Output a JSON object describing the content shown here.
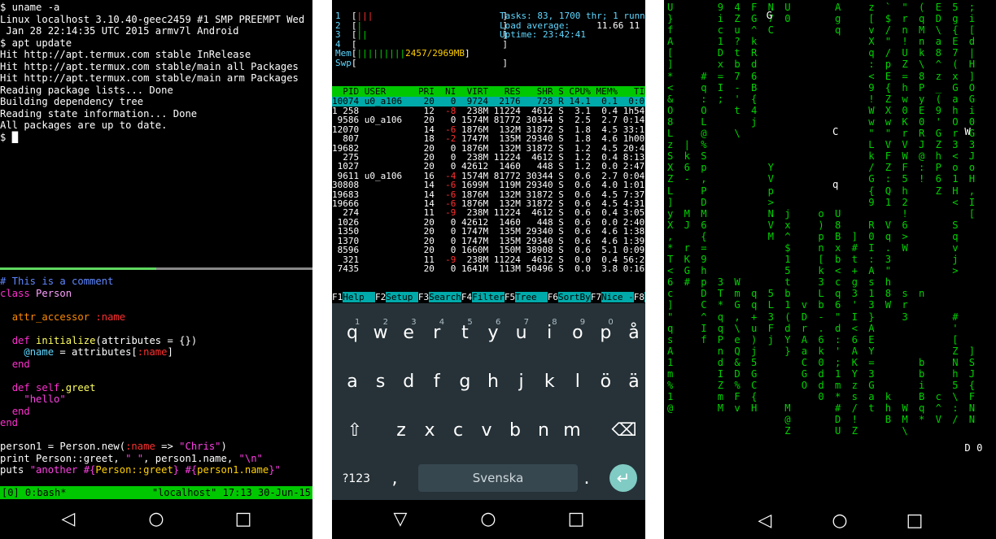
{
  "panel1": {
    "terminal_lines": [
      "$ uname -a",
      "Linux localhost 3.10.40-geec2459 #1 SMP PREEMPT Wed",
      " Jan 28 22:14:35 UTC 2015 armv7l Android",
      "$ apt update",
      "Hit http://apt.termux.com stable InRelease",
      "Hit http://apt.termux.com stable/main all Packages",
      "Hit http://apt.termux.com stable/main arm Packages",
      "Reading package lists... Done",
      "Building dependency tree",
      "Reading state information... Done",
      "All packages are up to date.",
      "$ "
    ],
    "code": {
      "comment": "# This is a comment",
      "class_kw": "class",
      "class_name": "Person",
      "attr_accessor": "attr_accessor",
      "attr_sym": ":name",
      "def1_kw": "def",
      "def1_name": "initialize",
      "def1_args": "(attributes = {})",
      "ivar": "@name",
      "ivar_assign": " = attributes[",
      "ivar_sym": ":name",
      "ivar_close": "]",
      "end1": "end",
      "def2_kw": "def",
      "def2_self": "self",
      "def2_name": ".greet",
      "hello": "\"hello\"",
      "end2": "end",
      "end3": "end",
      "line_new_a": "person1 = Person.new(",
      "line_new_sym": ":name",
      "line_new_b": " => ",
      "line_new_str": "\"Chris\"",
      "line_new_c": ")",
      "line_print_a": "print Person::greet, ",
      "line_print_s1": "\" \"",
      "line_print_b": ", person1.name, ",
      "line_print_s2": "\"\\n\"",
      "line_puts_a": "puts ",
      "line_puts_s": "\"another #{",
      "line_puts_m": "Person::greet",
      "line_puts_s2": "} #{",
      "line_puts_m2": "person1.name",
      "line_puts_s3": "}\""
    },
    "status_left": "[0] 0:bash*",
    "status_right": "\"localhost\" 17:13 30-Jun-15"
  },
  "panel2": {
    "cpu_lines": [
      "1  [|||                        ]",
      "2  [|                          ]",
      "3  [||                         ]",
      "4  [                           ]",
      "Mem[|||||||||2457/2969MB]",
      "Swp[                           ]"
    ],
    "tasks_line": "Tasks: 83, 1700 thr; 1 runni",
    "load_label": "Load average:",
    "load_value": "11.66 11",
    "uptime_line": "Uptime: 23:42:41",
    "header": "  PID USER      PRI  NI  VIRT   RES   SHR S CPU% MEM%   TIME",
    "selected_row": "10074 u0_a106    20   0  9724  2176   728 R 14.1  0.1  0:01.",
    "rows": [
      [
        "1 258",
        "",
        "12",
        "-8",
        "238M",
        "11224",
        "4612",
        "S",
        "3.1",
        "0.4",
        "1h54:"
      ],
      [
        "9586",
        "u0_a106",
        "20",
        "0",
        "1574M",
        "81772",
        "30344",
        "S",
        "2.5",
        "2.7",
        "0:14."
      ],
      [
        "12070",
        "",
        "14",
        "-6",
        "1876M",
        "132M",
        "31872",
        "S",
        "1.8",
        "4.5",
        "33:16."
      ],
      [
        "807",
        "",
        "18",
        "-2",
        "1747M",
        "135M",
        "29340",
        "S",
        "1.8",
        "4.6",
        "1h00:"
      ],
      [
        "19682",
        "",
        "20",
        "0",
        "1876M",
        "132M",
        "31872",
        "S",
        "1.2",
        "4.5",
        "20:45."
      ],
      [
        "275",
        "",
        "20",
        "0",
        "238M",
        "11224",
        "4612",
        "S",
        "1.2",
        "0.4",
        "8:13."
      ],
      [
        "1027",
        "",
        "20",
        "0",
        "42612",
        "1460",
        "448",
        "S",
        "1.2",
        "0.0",
        "2:47."
      ],
      [
        "9611",
        "u0_a106",
        "16",
        "-4",
        "1574M",
        "81772",
        "30344",
        "S",
        "0.6",
        "2.7",
        "0:04."
      ],
      [
        "30808",
        "",
        "14",
        "-6",
        "1699M",
        "119M",
        "29340",
        "S",
        "0.6",
        "4.0",
        "1:01."
      ],
      [
        "19683",
        "",
        "14",
        "-6",
        "1876M",
        "132M",
        "31872",
        "S",
        "0.6",
        "4.5",
        "7:37."
      ],
      [
        "19666",
        "",
        "14",
        "-6",
        "1876M",
        "132M",
        "31872",
        "S",
        "0.6",
        "4.5",
        "4:31."
      ],
      [
        "274",
        "",
        "11",
        "-9",
        "238M",
        "11224",
        "4612",
        "S",
        "0.6",
        "0.4",
        "3:05."
      ],
      [
        "1026",
        "",
        "20",
        "0",
        "42612",
        "1460",
        "448",
        "S",
        "0.6",
        "0.0",
        "2:40."
      ],
      [
        "1350",
        "",
        "20",
        "0",
        "1747M",
        "135M",
        "29340",
        "S",
        "0.6",
        "4.6",
        "1:38."
      ],
      [
        "1370",
        "",
        "20",
        "0",
        "1747M",
        "135M",
        "29340",
        "S",
        "0.6",
        "4.6",
        "1:39."
      ],
      [
        "8596",
        "",
        "20",
        "0",
        "1660M",
        "150M",
        "38908",
        "S",
        "0.6",
        "5.1",
        "0:09."
      ],
      [
        "321",
        "",
        "11",
        "-9",
        "238M",
        "11224",
        "4612",
        "S",
        "0.0",
        "0.4",
        "56:22."
      ],
      [
        "7435",
        "",
        "20",
        "0",
        "1641M",
        "113M",
        "50496",
        "S",
        "0.0",
        "3.8",
        "0:16."
      ]
    ],
    "fkeys": [
      {
        "k": "F1",
        "v": "Help  "
      },
      {
        "k": "F2",
        "v": "Setup "
      },
      {
        "k": "F3",
        "v": "Search"
      },
      {
        "k": "F4",
        "v": "Filter"
      },
      {
        "k": "F5",
        "v": "Tree  "
      },
      {
        "k": "F6",
        "v": "SortBy"
      },
      {
        "k": "F7",
        "v": "Nice -"
      },
      {
        "k": "F8",
        "v": "Ni"
      }
    ],
    "keyboard": {
      "row1": [
        "q",
        "w",
        "e",
        "r",
        "t",
        "y",
        "u",
        "i",
        "o",
        "p",
        "å"
      ],
      "row1_hints": [
        "1",
        "2",
        "3",
        "4",
        "5",
        "6",
        "7",
        "8",
        "9",
        "0",
        ""
      ],
      "row2": [
        "a",
        "s",
        "d",
        "f",
        "g",
        "h",
        "j",
        "k",
        "l",
        "ö",
        "ä"
      ],
      "row3": [
        "z",
        "x",
        "c",
        "v",
        "b",
        "n",
        "m"
      ],
      "symbols": "?123",
      "comma": ",",
      "space": "Svenska",
      "period": "."
    }
  },
  "panel3": {
    "columns": [
      {
        "c": "U\n}\nf\nA\n[\n]\n*\n<\n&\nO\n8\nL\nz\nS\nX\nZ\nL\n]\ny\nX\n,\n*\nT\n<\n6\nc\n]\n\"\nq\ns\nA\n1\nm\n%\n1\n@",
        "w": ""
      },
      {
        "c": "\n\n\n\n\n\n\n\n\n\n\n\n|\nk\n6\n-\n\n\nM\nJ\n\nr\nK\nG\n#\n",
        "w": ""
      },
      {
        "c": "\n\n\n\n\n\n#\nq\n:\nO\nL\n@\n%\nS\np\n,\nP\nD\nM\n6\n{\n=\n9\nh\np\nD\nC\n^\nI\nf",
        "w": ""
      },
      {
        "c": "9\ni\nc\n1\nD\nx\n=\nI\n;\n\n\n\n\n\n\n\n\n\n\n\n\n\n\n\n3\nT\n*\nq\nq\nP\nn\nd\nI\nZ\nm\nM",
        "w": ""
      },
      {
        "c": "4\nZ\nu\n?\nt\nb\n7\n-\n'\nt\n\n\\\n\n\n\n\n\n\n\n\n\n\n\n\nW\nm\nG\n,\n\\\ne\nQ\n&\nD\n%\nF\nv",
        "w": ""
      },
      {
        "c": "F\nG\n^\nk\nR\nd\n6\nB\n{\n4\nj\n\n\n\n\n\n\n\n\n\n\n\n\n\n\nq\nq\n+\nu\n)\nj\n5\nG\nC\n{\nH",
        "w": "1"
      },
      {
        "c": "N\n7\nC\n\n\n\n\n\n\n\n\n\n\n\nY\nV\np\n>\nN\nV\nM\n\n\n\n\n5\nL\n3\nF\nj",
        "w": ""
      },
      {
        "c": "U\n0\n\n\n\n\n\n\n\n\n\n\n\n\n\n\n\n\nj\nx\n^\n$\n1\n5\nt\nb\n1\n(\nd\nY\n}\n\n\n\n\nM\n@\nZ",
        "w": ""
      },
      {
        "c": "\n\n\n\n\n\n\n\n\n\n\n\n\n\n\n\n\n\n\n\n\n\n\n\n\n\nv\nD\nr\nA\na\nC\nG\nO",
        "w": ""
      },
      {
        "c": "\n\n\n\n\n\n\n\n\n\n\n\n\n\n\n\n\n\no\n)\np\nn\n[\nk\n3\nL\nb\n-\n.\n6\nk\n0\nd\nd\n0",
        "w": ""
      },
      {
        "c": "A\ng\nq\n\n\n\n\n\n\n\n\n\n\n\n\n\n\n\nU\n8\nB\nx\nb\n<\nc\nq\n6\n\"\nd\n:\n'\n;\n1\nm\n*\n#\nD\nU",
        "w": ""
      },
      {
        "c": "\n\n\n\n\n\n\n\n\n\n\n\n\n\n\n\n\n\n\n\n]\n#\nt\n+\ng\n3\n'\nI\n<\n6\nA\nK\nY\nz\ns\n/\n!\nZ",
        "w": ""
      },
      {
        "c": "z\n[\nv\nX\nq\n:\n<\n9\n!\nW\nw\n\"\nL\nk\n/\nG\n{\n9\n\nR\n0\nI\n:\nA\ns\n1\n3\n}\nA\nE\nY\n=\n3\nG\na\nt",
        "w": ""
      },
      {
        "c": "`\n$\n/\n\"\n/\np\nE\n{\nZ\nX\nw\n\"\nV\nF\nZ\n:\nQ\n1\n\nV\nq\n.\n3\n\"\nh\n8\nW\n\n\n\n\n\n\n\nk\nh\nB",
        "w": ""
      },
      {
        "c": "\"\nr\nn\n!\nU\nZ\n=\nh\nw\n0\nK\nr\nV\nW\nF\n5\nh\n2\n!\n6\n>\nW\n\n\n\ns\nr\n3\n\n\n\n\n\n\n\nW\nM\n\\",
        "w": ""
      },
      {
        "c": "(\nq\nM\nn\nk\n\\\n8\nP\ny\nE\n0\nR\nJ\n@\n:\n!\n\n\n\n\n\n\n\n\n\nn\n\n\n\n\n\nb\nb\ni\nB\nq\n*",
        "w": ""
      },
      {
        "c": "E\nD\n\\\na\n8\n^\nz\n_\n(\n9\n'\nG\nZ\nh\nP\n6\nZ\n\n\n\n\n\n\n\n\n\n\n\n\n\n\n\n\n\nc\n^\nV",
        "w": ""
      },
      {
        "c": "5\ng\n{\nE\n7\n(\nx\nG\na\nh\nO\nr\n3\n<\no\n1\nH\n<\n\nS\nq\nv\nj\n>\n\n\n\n#\n'\n[\nZ\nN\nh\n5\n\\\n:\n/",
        "w": ""
      },
      {
        "c": ";\ni\n[\nd\n|\nH\n]\nO\nG\ni\n0\nG\n3\nJ\no\nH\n,\nI\n[\n\n\n\n\n\n\n\n\n\n\n\n]\nS\nJ\n{\nF\nN\nN",
        "w": ""
      }
    ]
  }
}
